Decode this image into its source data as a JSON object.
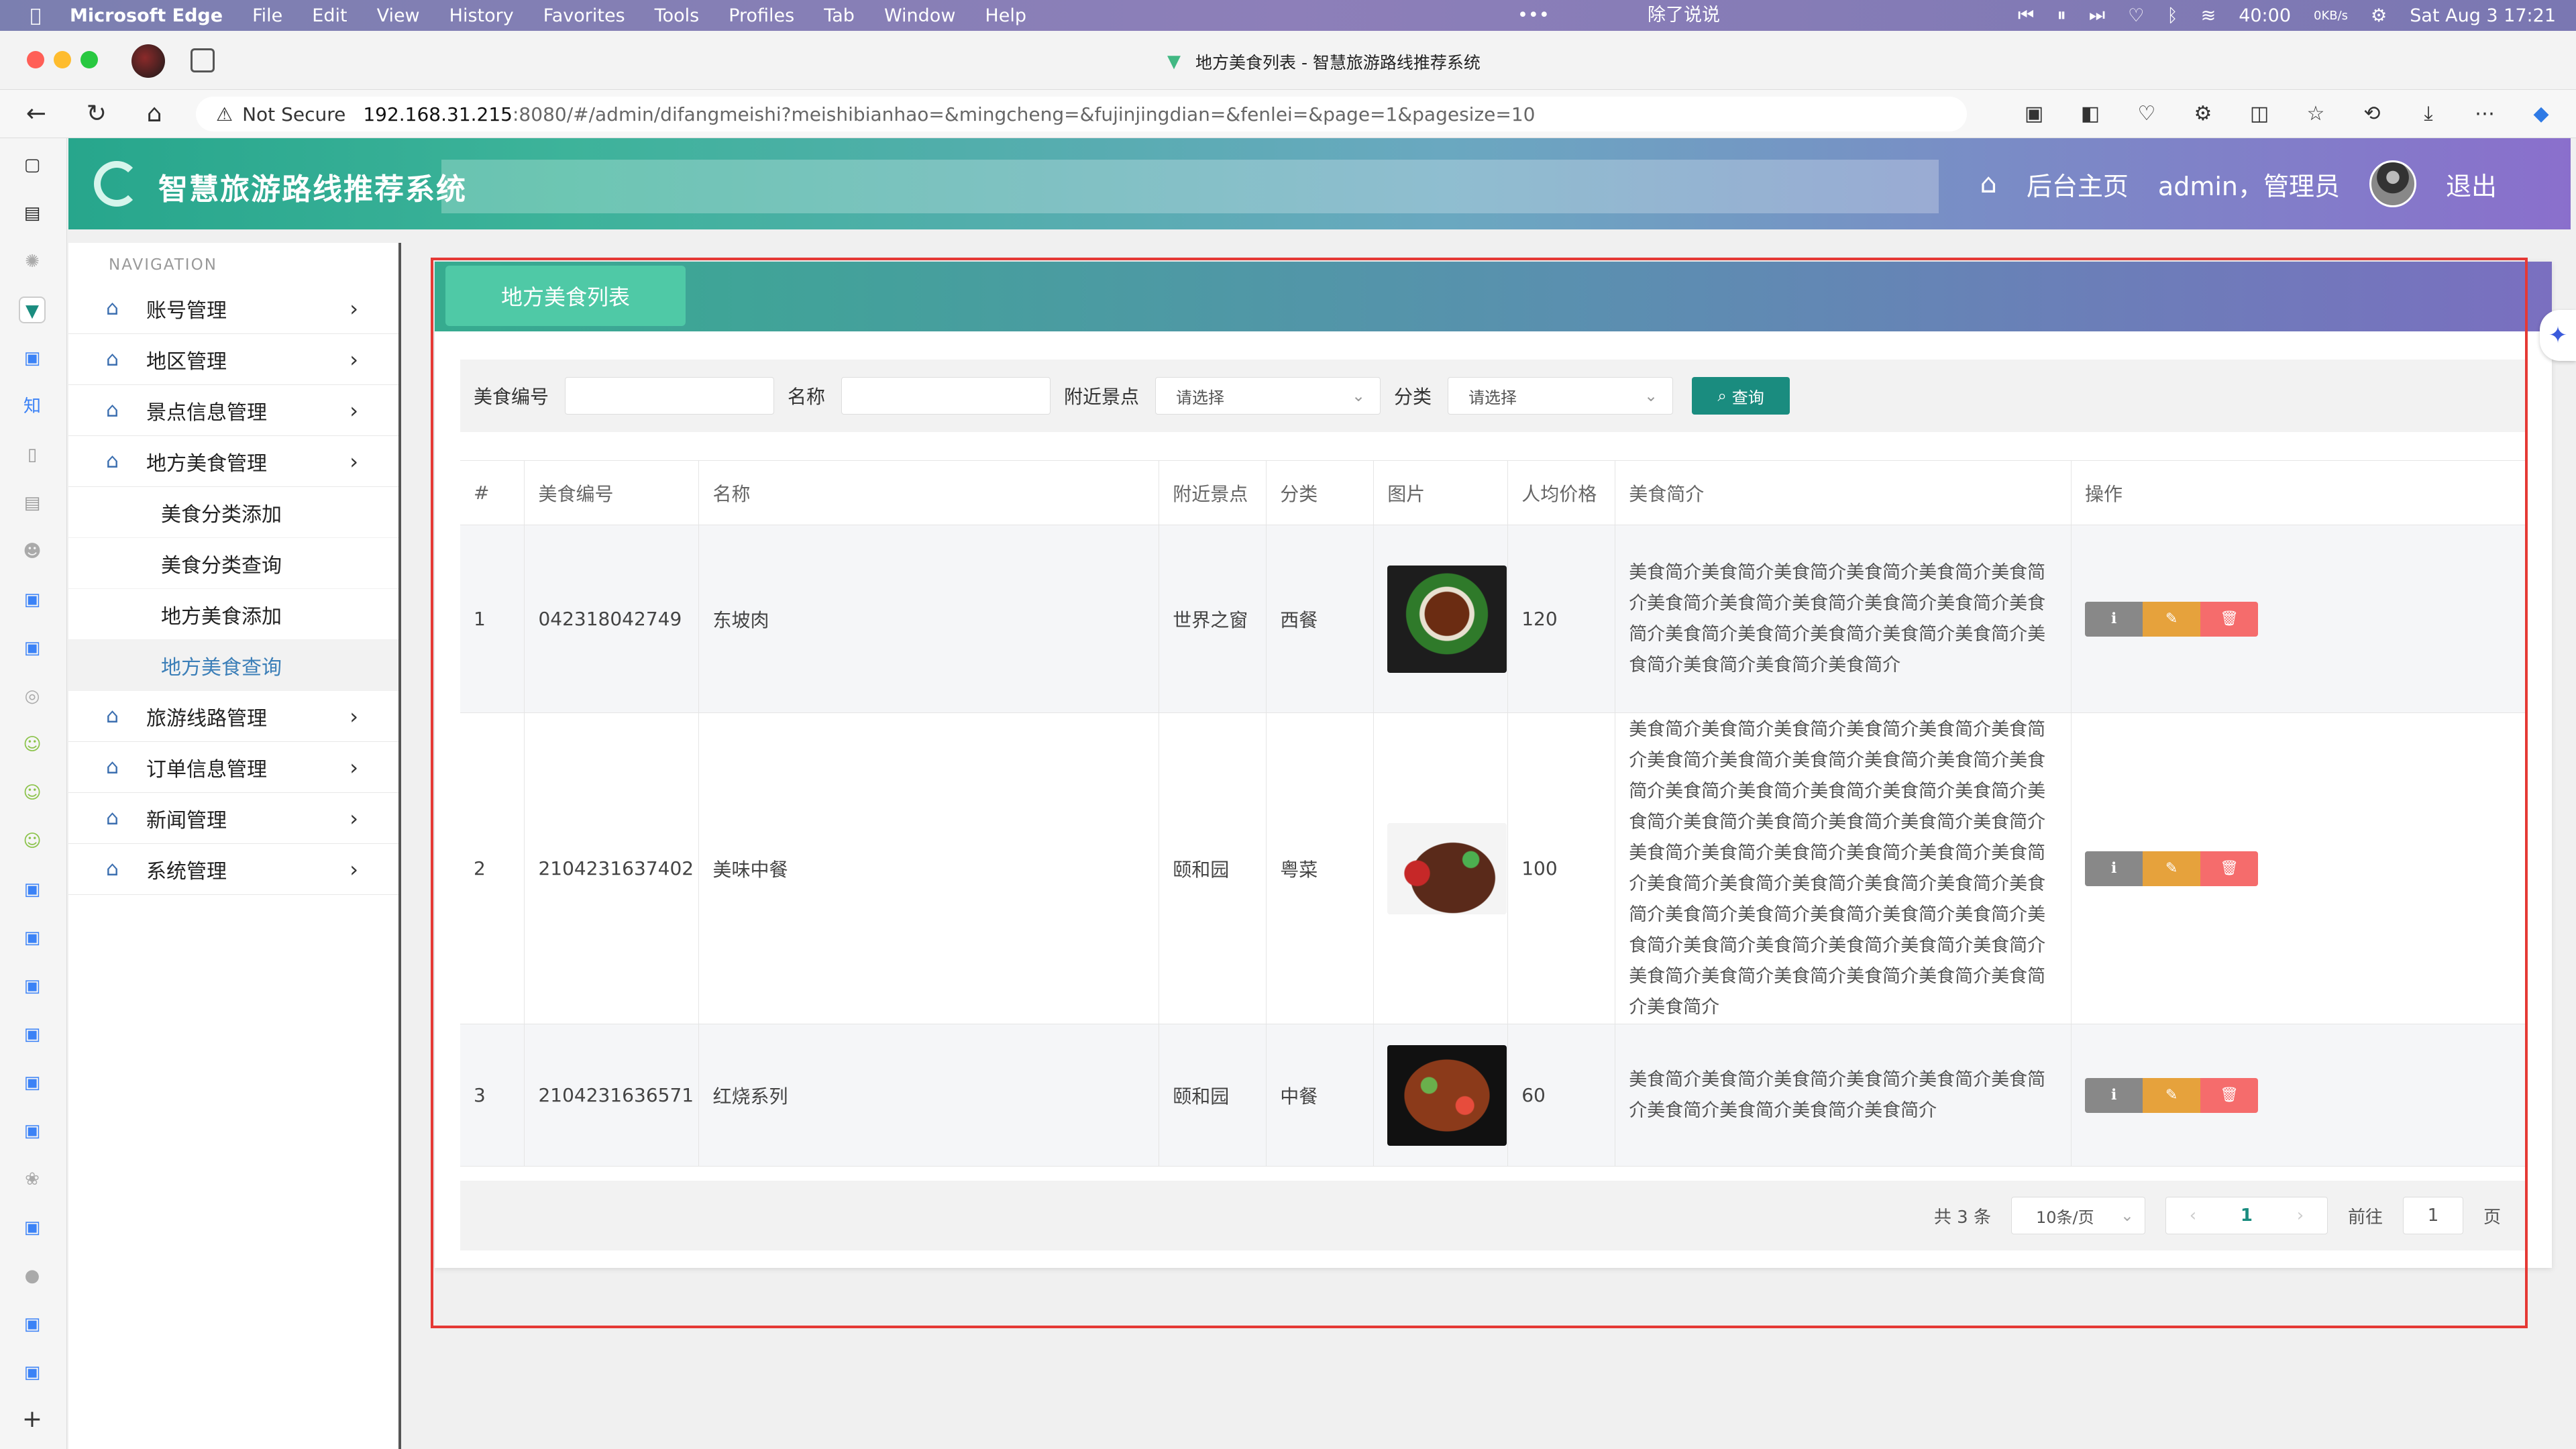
{
  "menubar": {
    "app_name": "Microsoft Edge",
    "items": [
      "File",
      "Edit",
      "View",
      "History",
      "Favorites",
      "Tools",
      "Profiles",
      "Tab",
      "Window",
      "Help"
    ],
    "center_text": "除了说说",
    "battery": "40:00",
    "net": "0KB/s",
    "datetime": "Sat Aug 3  17:21"
  },
  "browser": {
    "tab_title": "地方美食列表 - 智慧旅游路线推荐系统",
    "not_secure": "Not Secure",
    "url_host": "192.168.31.215",
    "url_path": ":8080/#/admin/difangmeishi?meishibianhao=&mingcheng=&fujinjingdian=&fenlei=&page=1&pagesize=10"
  },
  "header": {
    "title": "智慧旅游路线推荐系统",
    "home_link": "后台主页",
    "user": "admin，管理员",
    "logout": "退出"
  },
  "sidebar": {
    "heading": "NAVIGATION",
    "items": [
      {
        "label": "账号管理"
      },
      {
        "label": "地区管理"
      },
      {
        "label": "景点信息管理"
      },
      {
        "label": "地方美食管理"
      },
      {
        "label": "旅游线路管理"
      },
      {
        "label": "订单信息管理"
      },
      {
        "label": "新闻管理"
      },
      {
        "label": "系统管理"
      }
    ],
    "subitems": [
      {
        "label": "美食分类添加"
      },
      {
        "label": "美食分类查询"
      },
      {
        "label": "地方美食添加"
      },
      {
        "label": "地方美食查询"
      }
    ]
  },
  "page": {
    "tab_label": "地方美食列表",
    "search": {
      "code_label": "美食编号",
      "name_label": "名称",
      "spot_label": "附近景点",
      "spot_placeholder": "请选择",
      "category_label": "分类",
      "category_placeholder": "请选择",
      "query_button": "查询"
    },
    "table": {
      "headers": [
        "#",
        "美食编号",
        "名称",
        "附近景点",
        "分类",
        "图片",
        "人均价格",
        "美食简介",
        "操作"
      ],
      "rows": [
        {
          "index": "1",
          "code": "042318042749",
          "name": "东坡肉",
          "spot": "世界之窗",
          "category": "西餐",
          "price": "120",
          "desc": "美食简介美食简介美食简介美食简介美食简介美食简介美食简介美食简介美食简介美食简介美食简介美食简介美食简介美食简介美食简介美食简介美食简介美食简介美食简介美食简介美食简介"
        },
        {
          "index": "2",
          "code": "2104231637402",
          "name": "美味中餐",
          "spot": "颐和园",
          "category": "粤菜",
          "price": "100",
          "desc": "美食简介美食简介美食简介美食简介美食简介美食简介美食简介美食简介美食简介美食简介美食简介美食简介美食简介美食简介美食简介美食简介美食简介美食简介美食简介美食简介美食简介美食简介美食简介美食简介美食简介美食简介美食简介美食简介美食简介美食简介美食简介美食简介美食简介美食简介美食简介美食简介美食简介美食简介美食简介美食简介美食简介美食简介美食简介美食简介美食简介美食简介美食简介美食简介美食简介美食简介美食简介美食简介美食简介"
        },
        {
          "index": "3",
          "code": "2104231636571",
          "name": "红烧系列",
          "spot": "颐和园",
          "category": "中餐",
          "price": "60",
          "desc": "美食简介美食简介美食简介美食简介美食简介美食简介美食简介美食简介美食简介美食简介"
        }
      ]
    },
    "pager": {
      "total": "共 3 条",
      "page_size": "10条/页",
      "current": "1",
      "goto_label": "前往",
      "goto_value": "1",
      "page_suffix": "页"
    }
  },
  "colors": {
    "accent": "#1a8c7f",
    "header_start": "#27a68c",
    "header_end": "#8a6fcc",
    "edit": "#e6a23c",
    "delete": "#f56c6c",
    "highlight_frame": "#e53935"
  }
}
